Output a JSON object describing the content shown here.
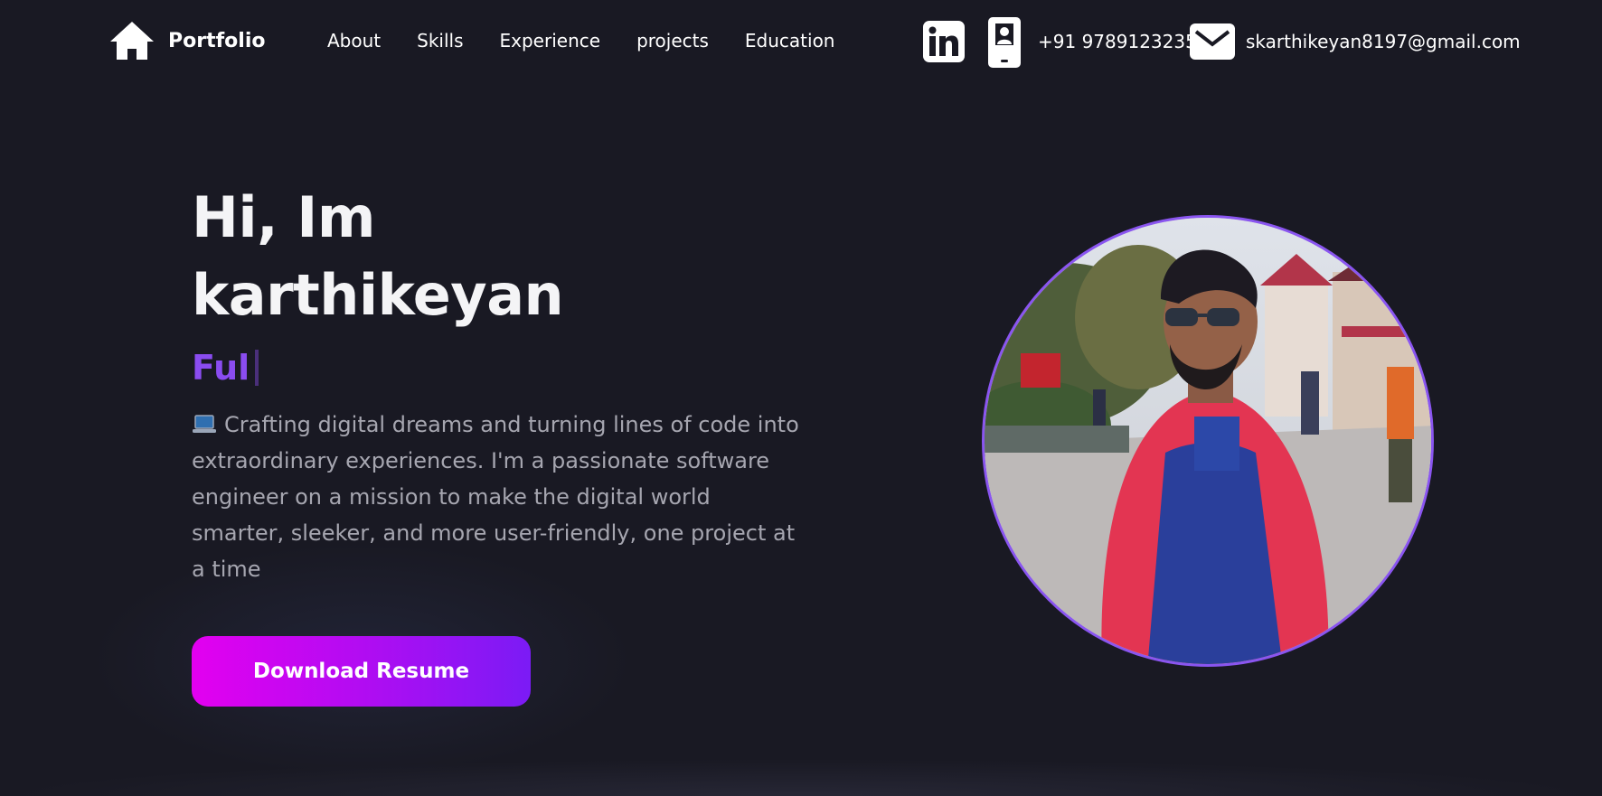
{
  "nav": {
    "brand_label": "Portfolio",
    "brand_icon": "home-icon",
    "links": [
      "About",
      "Skills",
      "Experience",
      "projects",
      "Education"
    ]
  },
  "contact": {
    "linkedin_icon": "linkedin-icon",
    "contact_card_icon": "contact-card-icon",
    "phone": "+91 9789123235",
    "mail_icon": "mail-icon",
    "email": "skarthikeyan8197@gmail.com"
  },
  "hero": {
    "title_line1": "Hi, Im",
    "title_line2": "karthikeyan",
    "typed_text": "Ful",
    "bio_icon": "laptop-icon",
    "bio": "Crafting digital dreams and turning lines of code into extraordinary experiences. I'm a passionate software engineer on a mission to make the digital world smarter, sleeker, and more user-friendly, one project at a time",
    "button_label": "Download Resume"
  },
  "colors": {
    "background": "#191923",
    "accent_purple": "#8a4cf0",
    "button_gradient_start": "#e300f0",
    "button_gradient_end": "#7b1bf5",
    "avatar_border": "#8a55f0"
  }
}
